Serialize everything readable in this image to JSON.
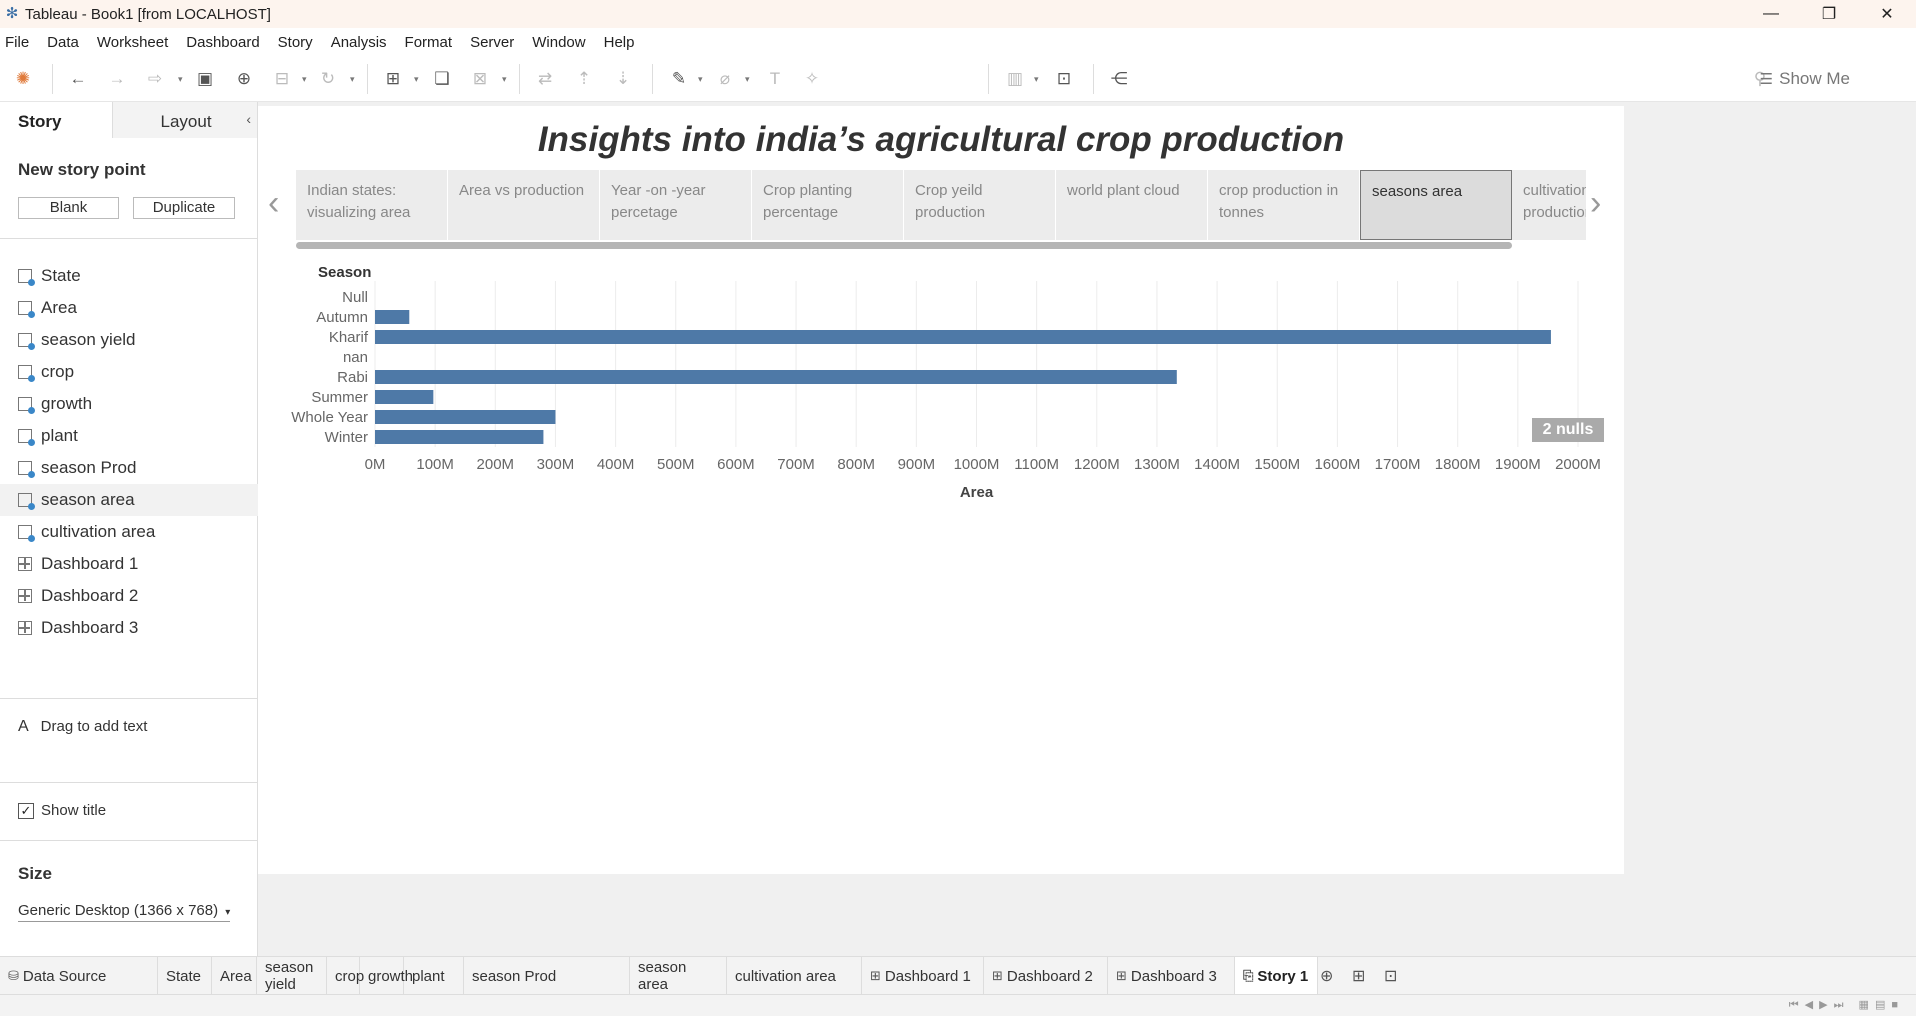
{
  "window": {
    "title": "Tableau - Book1 [from LOCALHOST]",
    "controls": [
      "—",
      "❐",
      "✕"
    ]
  },
  "menu": [
    "File",
    "Data",
    "Worksheet",
    "Dashboard",
    "Story",
    "Analysis",
    "Format",
    "Server",
    "Window",
    "Help"
  ],
  "toolbar": {
    "show_me_label": "Show Me"
  },
  "left_panel": {
    "tabs": {
      "story": "Story",
      "layout": "Layout"
    },
    "new_story_point": "New story point",
    "blank_button": "Blank",
    "duplicate_button": "Duplicate",
    "sheets": [
      {
        "label": "State",
        "kind": "sheet"
      },
      {
        "label": "Area",
        "kind": "sheet"
      },
      {
        "label": "season yield",
        "kind": "sheet"
      },
      {
        "label": "crop",
        "kind": "sheet"
      },
      {
        "label": "growth",
        "kind": "sheet"
      },
      {
        "label": "plant",
        "kind": "sheet"
      },
      {
        "label": "season Prod",
        "kind": "sheet"
      },
      {
        "label": "season area",
        "kind": "sheet",
        "selected": true
      },
      {
        "label": "cultivation area",
        "kind": "sheet"
      },
      {
        "label": "Dashboard 1",
        "kind": "dashboard"
      },
      {
        "label": "Dashboard 2",
        "kind": "dashboard"
      },
      {
        "label": "Dashboard 3",
        "kind": "dashboard"
      }
    ],
    "drag_text": "Drag to add text",
    "show_title_label": "Show title",
    "show_title_checked": true,
    "size_heading": "Size",
    "size_value": "Generic Desktop (1366 x 768)"
  },
  "story": {
    "title": "Insights into india’s agricultural crop production",
    "points": [
      {
        "label": "Indian  states: visualizing area",
        "active": false
      },
      {
        "label": "Area vs production",
        "active": false
      },
      {
        "label": "Year -on -year percetage",
        "active": false
      },
      {
        "label": "Crop planting percentage",
        "active": false
      },
      {
        "label": "Crop yeild production",
        "active": false
      },
      {
        "label": "world plant cloud",
        "active": false
      },
      {
        "label": "crop production in tonnes",
        "active": false
      },
      {
        "label": "seasons area",
        "active": true
      },
      {
        "label": "cultivation production",
        "active": false
      }
    ]
  },
  "chart_data": {
    "type": "bar",
    "orientation": "horizontal",
    "ylabel": "Season",
    "xlabel": "Area",
    "categories": [
      "Null",
      "Autumn",
      "Kharif",
      "nan",
      "Rabi",
      "Summer",
      "Whole Year",
      "Winter"
    ],
    "values": [
      0,
      57000000,
      1955000000,
      0,
      1333000000,
      97000000,
      300000000,
      280000000
    ],
    "xlim": [
      0,
      2000000000
    ],
    "xticks": [
      "0M",
      "100M",
      "200M",
      "300M",
      "400M",
      "500M",
      "600M",
      "700M",
      "800M",
      "900M",
      "1000M",
      "1100M",
      "1200M",
      "1300M",
      "1400M",
      "1500M",
      "1600M",
      "1700M",
      "1800M",
      "1900M",
      "2000M"
    ],
    "bar_color": "#4e79a7",
    "grid": true,
    "nulls_badge": "2 nulls"
  },
  "bottom_tabs": [
    {
      "label": "Data Source",
      "glyph": "⛁"
    },
    {
      "label": "State"
    },
    {
      "label": "Area"
    },
    {
      "label": "season yield"
    },
    {
      "label": "crop"
    },
    {
      "label": "growth"
    },
    {
      "label": "plant"
    },
    {
      "label": "season Prod"
    },
    {
      "label": "season area"
    },
    {
      "label": "cultivation area"
    },
    {
      "label": "Dashboard 1",
      "glyph": "⊞"
    },
    {
      "label": "Dashboard 2",
      "glyph": "⊞"
    },
    {
      "label": "Dashboard 3",
      "glyph": "⊞"
    },
    {
      "label": "Story 1",
      "glyph": "⎘",
      "active": true
    }
  ],
  "colors": {
    "accent": "#4e79a7",
    "titlebar": "#fdf4ee",
    "badge": "#aaaaaa"
  }
}
